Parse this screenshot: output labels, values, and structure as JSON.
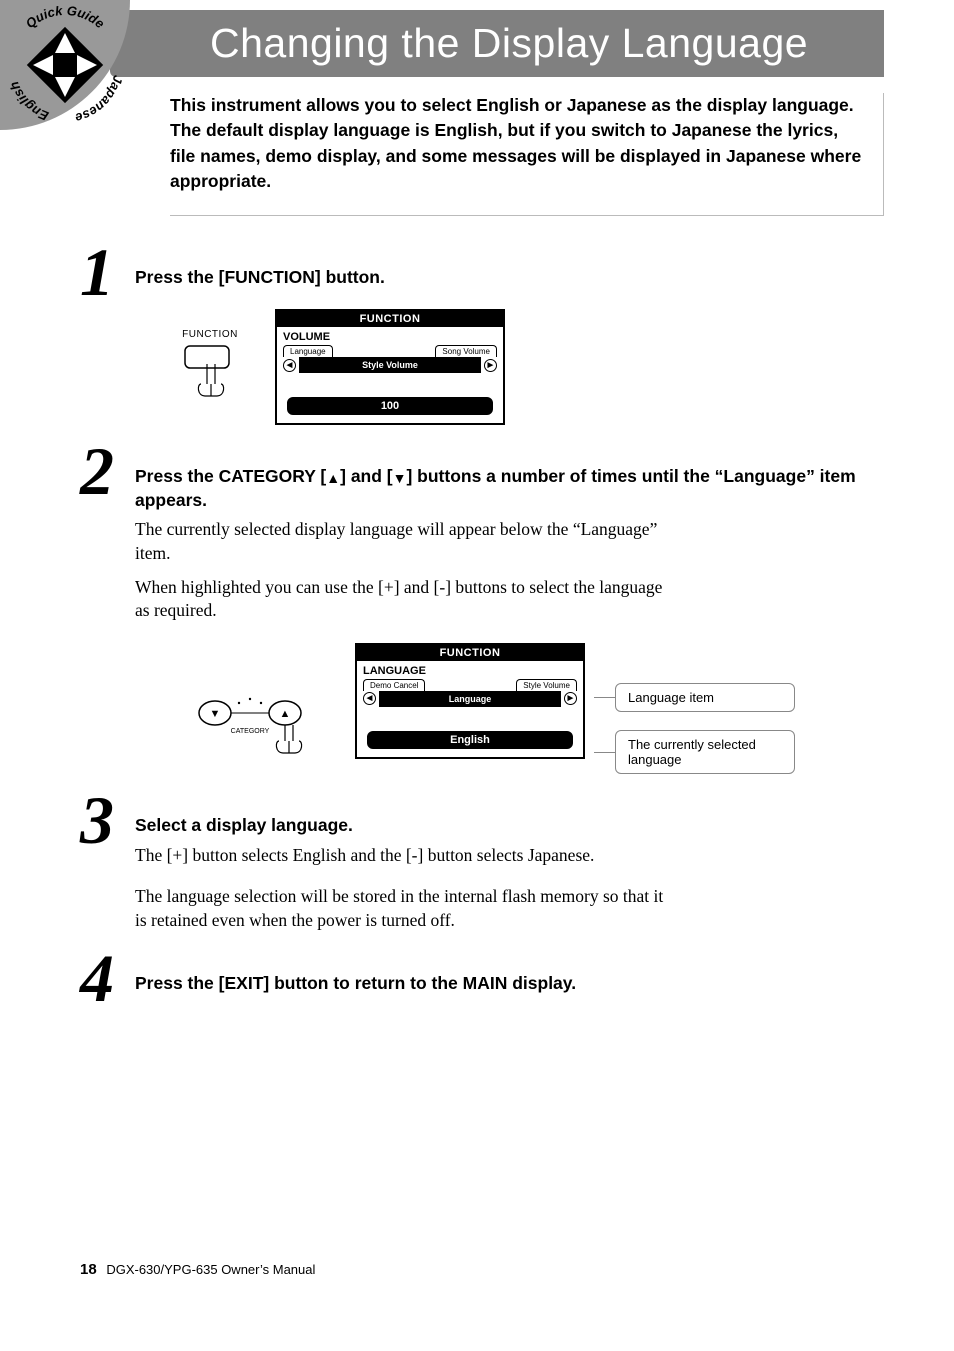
{
  "badge": {
    "top": "Quick Guide",
    "left": "English",
    "right": "Japanese"
  },
  "title": "Changing the Display Language",
  "intro": "This instrument allows you to select English or Japanese as the display language. The default display language is English, but if you switch to Japanese the lyrics, file names, demo display, and some messages will be displayed in Japanese where appropriate.",
  "steps": {
    "s1": {
      "num": "1",
      "title": "Press the [FUNCTION] button.",
      "button_label": "FUNCTION",
      "lcd": {
        "header": "FUNCTION",
        "section": "VOLUME",
        "tab_left": "Language",
        "tab_right": "Song Volume",
        "mid": "Style Volume",
        "value": "100"
      }
    },
    "s2": {
      "num": "2",
      "title_a": "Press the CATEGORY [",
      "title_b": "] and [",
      "title_c": "] buttons a number of times until the “Language” item appears.",
      "body1": "The currently selected display language will appear below the “Language” item.",
      "body2": "When highlighted you can use the [+] and [-] buttons to select the language as required.",
      "dial_label": "CATEGORY",
      "lcd": {
        "header": "FUNCTION",
        "section": "LANGUAGE",
        "tab_left": "Demo Cancel",
        "tab_right": "Style Volume",
        "mid": "Language",
        "value": "English"
      },
      "callout1": "Language item",
      "callout2": "The currently selected language"
    },
    "s3": {
      "num": "3",
      "title": "Select a display language.",
      "body1": "The [+] button selects English and the [-] button selects Japanese.",
      "body2": "The language selection will be stored in the internal flash memory so that it is retained even when the power is turned off."
    },
    "s4": {
      "num": "4",
      "title": "Press the [EXIT] button to return to the MAIN display."
    }
  },
  "footer": {
    "page": "18",
    "doc": "DGX-630/YPG-635  Owner’s Manual"
  }
}
